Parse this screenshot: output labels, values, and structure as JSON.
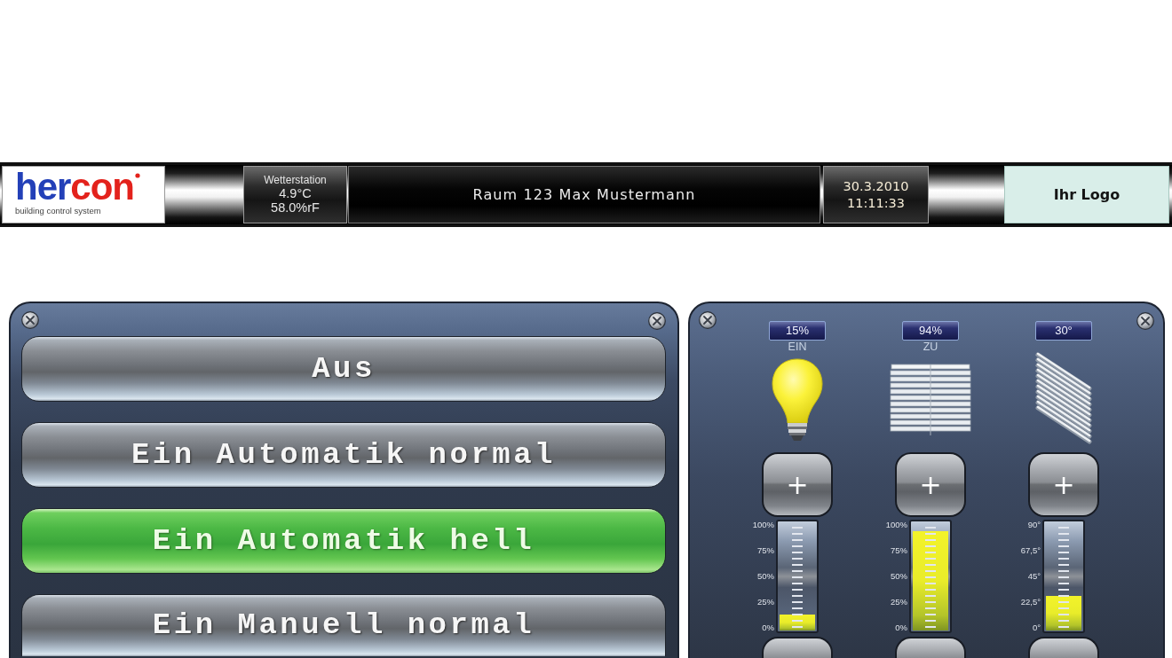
{
  "header": {
    "logo": {
      "wordmark": [
        "her",
        "con"
      ],
      "tagline": "building control system"
    },
    "weather": {
      "title": "Wetterstation",
      "temperature": "4.9°C",
      "humidity": "58.0%rF"
    },
    "room_title": "Raum 123 Max Mustermann",
    "date": "30.3.2010",
    "time": "11:11:33",
    "customer_logo": "Ihr Logo"
  },
  "mode_panel": {
    "modes": [
      {
        "label": "Aus",
        "selected": false
      },
      {
        "label": "Ein Automatik normal",
        "selected": false
      },
      {
        "label": "Ein Automatik hell",
        "selected": true
      },
      {
        "label": "Ein Manuell normal",
        "selected": false
      }
    ]
  },
  "control_panel": {
    "channels": [
      {
        "kind": "light",
        "readout": "15%",
        "state_label": "EIN",
        "up_button": "+",
        "level": 0.15,
        "scale": [
          "100%",
          "75%",
          "50%",
          "25%",
          "0%"
        ]
      },
      {
        "kind": "blind",
        "readout": "94%",
        "state_label": "ZU",
        "up_button": "+",
        "level": 0.94,
        "scale": [
          "100%",
          "75%",
          "50%",
          "25%",
          "0%"
        ]
      },
      {
        "kind": "slats",
        "readout": "30°",
        "up_button": "+",
        "level": 0.33,
        "scale": [
          "90°",
          "67,5°",
          "45°",
          "22,5°",
          "0°"
        ]
      }
    ]
  }
}
